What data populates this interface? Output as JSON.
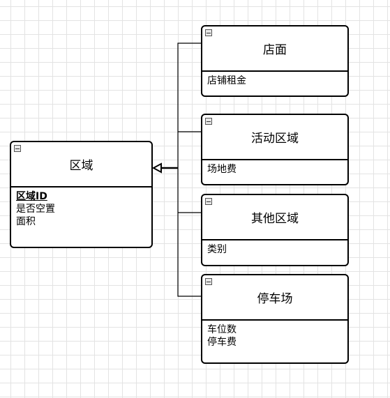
{
  "entities": {
    "area": {
      "title": "区域",
      "pk": "区域ID",
      "attrs": [
        "是否空置",
        "面积"
      ]
    },
    "store": {
      "title": "店面",
      "attrs": [
        "店铺租金"
      ]
    },
    "activity": {
      "title": "活动区域",
      "attrs": [
        "场地费"
      ]
    },
    "other": {
      "title": "其他区域",
      "attrs": [
        "类别"
      ]
    },
    "parking": {
      "title": "停车场",
      "attrs": [
        "车位数",
        "停车费"
      ]
    }
  }
}
